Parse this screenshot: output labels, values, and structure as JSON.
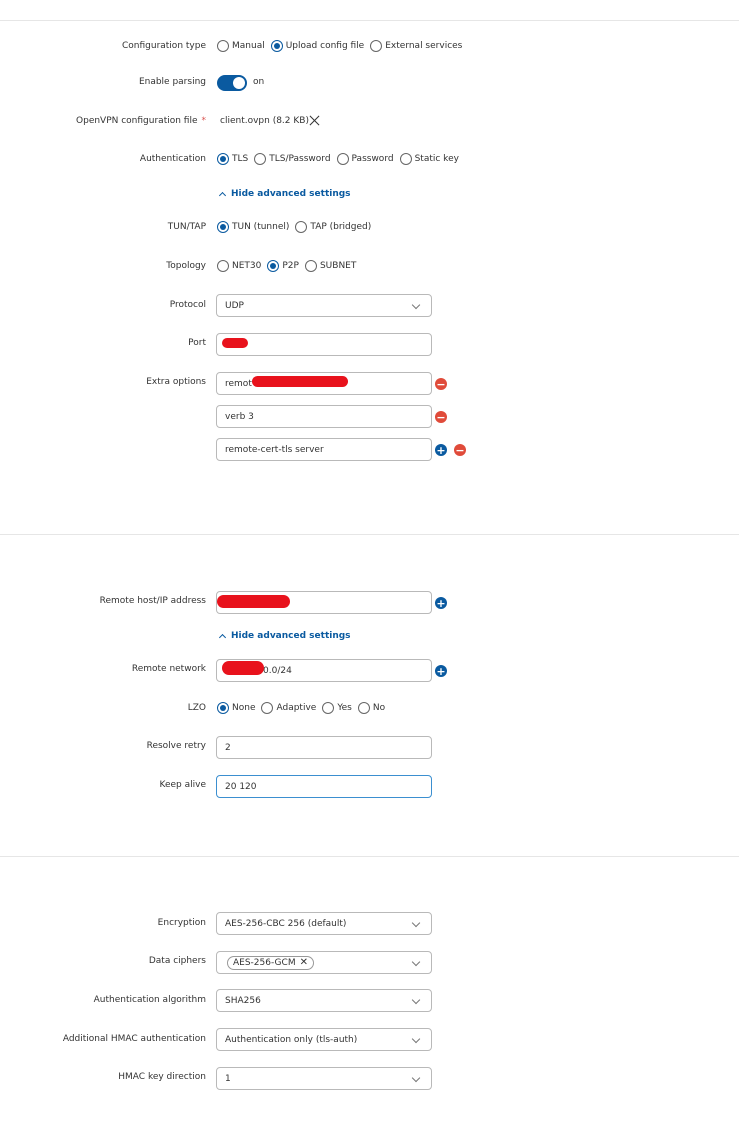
{
  "general": {
    "config_type": {
      "label": "Configuration type",
      "options": [
        "Manual",
        "Upload config file",
        "External services"
      ],
      "selected": "Upload config file"
    },
    "parsing": {
      "label": "Enable parsing",
      "state": "on"
    },
    "config_file": {
      "label": "OpenVPN configuration file",
      "required_mark": "*",
      "file": "client.ovpn (8.2 KB)"
    },
    "authentication": {
      "label": "Authentication",
      "options": [
        "TLS",
        "TLS/Password",
        "Password",
        "Static key"
      ],
      "selected": "TLS"
    },
    "hide_advanced_1": "Hide advanced settings",
    "tun_tap": {
      "label": "TUN/TAP",
      "options": [
        "TUN (tunnel)",
        "TAP (bridged)"
      ],
      "selected": "TUN (tunnel)"
    },
    "topology": {
      "label": "Topology",
      "options": [
        "NET30",
        "P2P",
        "SUBNET"
      ],
      "selected": "P2P"
    },
    "protocol": {
      "label": "Protocol",
      "value": "UDP"
    },
    "port": {
      "label": "Port",
      "value": ""
    },
    "extra_options": {
      "label": "Extra options",
      "values": [
        "remot",
        "verb 3",
        "remote-cert-tls server"
      ]
    }
  },
  "remote": {
    "host": {
      "label": "Remote host/IP address",
      "value": ""
    },
    "hide_advanced_2": "Hide advanced settings",
    "network": {
      "label": "Remote network",
      "value": "0.0/24"
    },
    "lzo": {
      "label": "LZO",
      "options": [
        "None",
        "Adaptive",
        "Yes",
        "No"
      ],
      "selected": "None"
    },
    "resolve_retry": {
      "label": "Resolve retry",
      "value": "2"
    },
    "keep_alive": {
      "label": "Keep alive",
      "value": "20 120"
    }
  },
  "security": {
    "encryption": {
      "label": "Encryption",
      "value": "AES-256-CBC 256 (default)"
    },
    "data_ciphers": {
      "label": "Data ciphers",
      "tag": "AES-256-GCM"
    },
    "auth_algorithm": {
      "label": "Authentication algorithm",
      "value": "SHA256"
    },
    "hmac_auth": {
      "label": "Additional HMAC authentication",
      "value": "Authentication only (tls-auth)"
    },
    "hmac_direction": {
      "label": "HMAC key direction",
      "value": "1"
    }
  },
  "colors": {
    "accent": "#0a5aa0",
    "remove": "#e04b3a",
    "redaction": "#e8121c"
  }
}
